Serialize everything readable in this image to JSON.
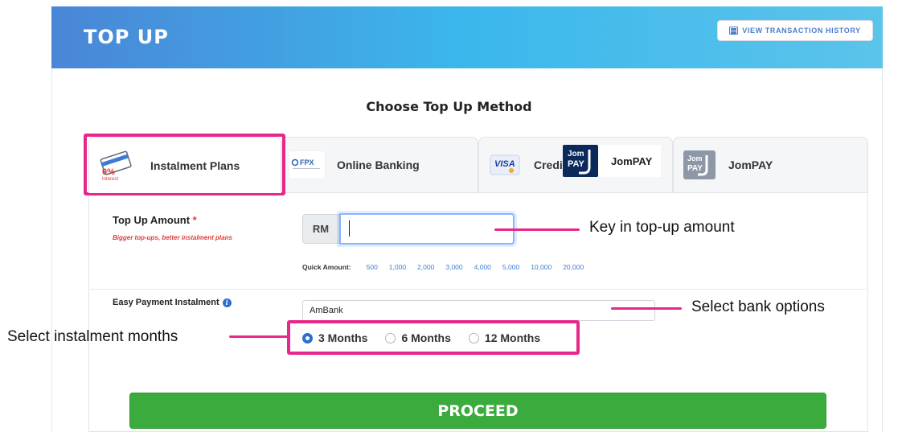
{
  "header": {
    "title": "TOP UP",
    "history_label": "VIEW TRANSACTION HISTORY"
  },
  "method_title": "Choose Top Up Method",
  "tabs": [
    {
      "label": "Instalment Plans",
      "icon": "zero-interest-card-icon",
      "icon_text": "0%",
      "icon_sub": "Interest",
      "selected": true
    },
    {
      "label": "Online Banking",
      "icon": "fpx-logo-icon",
      "icon_text": "FPX"
    },
    {
      "label": "Credit",
      "icon": "visa-card-icon",
      "icon_text": "VISA"
    },
    {
      "label": "JomPAY",
      "icon": "jompay-logo-icon"
    }
  ],
  "jompay_popup": {
    "label": "JomPAY"
  },
  "amount": {
    "label": "Top Up Amount",
    "required_mark": "*",
    "note": "Bigger top-ups, better instalment plans",
    "currency": "RM",
    "value": ""
  },
  "quick_amount": {
    "label": "Quick Amount:",
    "values": [
      "500",
      "1,000",
      "2,000",
      "3,000",
      "4,000",
      "5,000",
      "10,000",
      "20,000"
    ]
  },
  "instalment": {
    "label": "Easy Payment Instalment",
    "bank_selected": "AmBank",
    "months": [
      {
        "label": "3 Months",
        "selected": true
      },
      {
        "label": "6 Months",
        "selected": false
      },
      {
        "label": "12 Months",
        "selected": false
      }
    ]
  },
  "proceed_label": "PROCEED",
  "annotations": {
    "amount": "Key in top-up amount",
    "bank": "Select bank options",
    "months": "Select instalment months"
  },
  "colors": {
    "highlight": "#e8278a",
    "proceed": "#3cab3e",
    "link": "#3d7fd6",
    "header_start": "#4a86d6",
    "header_end": "#5bc4ea"
  }
}
